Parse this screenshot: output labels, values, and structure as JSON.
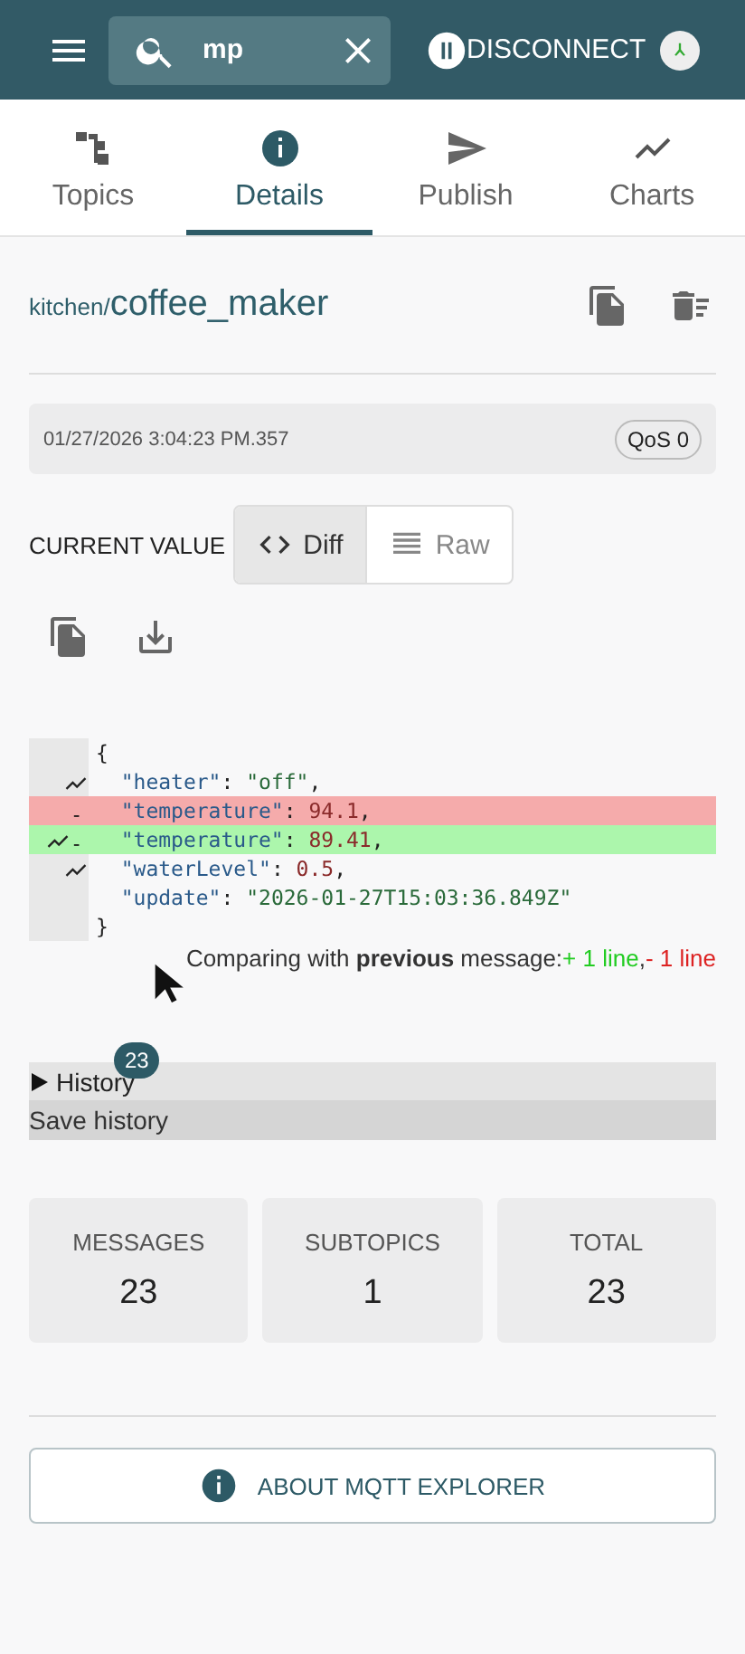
{
  "app_bar": {
    "search": {
      "value": "mp"
    },
    "pause_label": "DISCONNECT"
  },
  "tabs": [
    {
      "label": "Topics",
      "selected": false
    },
    {
      "label": "Details",
      "selected": true
    },
    {
      "label": "Publish",
      "selected": false
    },
    {
      "label": "Charts",
      "selected": false
    }
  ],
  "topic": {
    "path": "kitchen/",
    "name": "coffee_maker"
  },
  "message": {
    "timestamp": "01/27/2026 3:04:23 PM.357",
    "qos": "QoS 0"
  },
  "current_value": {
    "label": "CURRENT VALUE",
    "modes": [
      {
        "label": "Diff",
        "selected": true
      },
      {
        "label": "Raw",
        "selected": false
      }
    ]
  },
  "diff_lines": [
    {
      "kind": "normal",
      "chart": false,
      "tokens": [
        {
          "kind": "punct",
          "text": "{"
        }
      ]
    },
    {
      "kind": "normal",
      "chart": true,
      "tokens": [
        {
          "kind": "key",
          "text": "  \"heater\""
        },
        {
          "kind": "punct",
          "text": ": "
        },
        {
          "kind": "str",
          "text": "\"off\""
        },
        {
          "kind": "punct",
          "text": ","
        }
      ]
    },
    {
      "kind": "removed",
      "chart": false,
      "marker": "-",
      "tokens": [
        {
          "kind": "key",
          "text": "  \"temperature\""
        },
        {
          "kind": "punct",
          "text": ": "
        },
        {
          "kind": "num",
          "text": "94.1"
        },
        {
          "kind": "punct",
          "text": ","
        }
      ]
    },
    {
      "kind": "added",
      "chart": true,
      "marker": "-",
      "tokens": [
        {
          "kind": "key",
          "text": "  \"temperature\""
        },
        {
          "kind": "punct",
          "text": ": "
        },
        {
          "kind": "num",
          "text": "89.41"
        },
        {
          "kind": "punct",
          "text": ","
        }
      ]
    },
    {
      "kind": "normal",
      "chart": true,
      "tokens": [
        {
          "kind": "key",
          "text": "  \"waterLevel\""
        },
        {
          "kind": "punct",
          "text": ": "
        },
        {
          "kind": "num",
          "text": "0.5"
        },
        {
          "kind": "punct",
          "text": ","
        }
      ]
    },
    {
      "kind": "normal",
      "chart": false,
      "tokens": [
        {
          "kind": "key",
          "text": "  \"update\""
        },
        {
          "kind": "punct",
          "text": ": "
        },
        {
          "kind": "str",
          "text": "\"2026-01-27T15:03:36.849Z\""
        }
      ]
    },
    {
      "kind": "normal",
      "chart": false,
      "tokens": [
        {
          "kind": "punct",
          "text": "}"
        }
      ]
    }
  ],
  "comparison": {
    "text": "Comparing with **previous** message: ",
    "added": "+ 1 line",
    "separator": ", ",
    "removed": "- 1 line"
  },
  "history": {
    "label": "History",
    "count": "23",
    "expanded": false
  },
  "save_history": "Save history",
  "stats": [
    {
      "label": "MESSAGES",
      "value": "23"
    },
    {
      "label": "SUBTOPICS",
      "value": "1"
    },
    {
      "label": "TOTAL",
      "value": "23"
    }
  ],
  "about_button": "ABOUT MQTT EXPLORER"
}
